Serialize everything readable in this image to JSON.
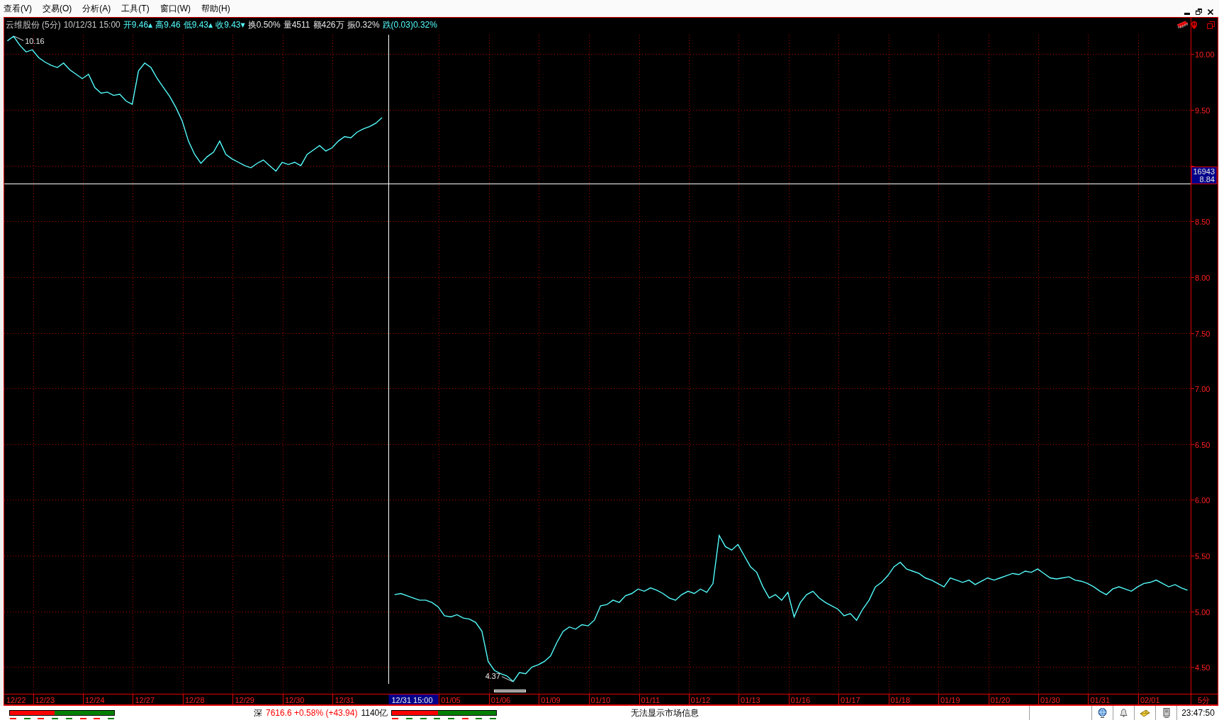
{
  "menu": [
    "查看(V)",
    "交易(O)",
    "分析(A)",
    "工具(T)",
    "窗口(W)",
    "帮助(H)"
  ],
  "chart": {
    "stock_name": "云维股份",
    "period": "(5分)",
    "time": "10/12/31 15:00",
    "quote_fields": [
      {
        "text": "开9.46",
        "arrow": "▲",
        "color": "#54fcfc"
      },
      {
        "text": "高9.46",
        "color": "#54fcfc"
      },
      {
        "text": "低9.43",
        "arrow": "▲",
        "color": "#54fcfc"
      },
      {
        "text": "收9.43",
        "arrow": "▼",
        "color": "#54fcfc"
      },
      {
        "text": "换0.50%",
        "color": "#e6e6e6"
      },
      {
        "text": "量4511",
        "color": "#e6e6e6"
      },
      {
        "text": "额426万",
        "color": "#e6e6e6"
      },
      {
        "text": "振0.32%",
        "color": "#e6e6e6"
      },
      {
        "text": "跌(0.03)0.32%",
        "color": "#54fcfc"
      }
    ],
    "corner_label": "5分",
    "crosshair": {
      "date_label": "12/31 15:00",
      "value_label": "16943"
    },
    "chart_data": {
      "type": "line",
      "grid": true,
      "categories": [
        null,
        "12/22",
        null,
        null,
        null,
        null,
        "12/23",
        null,
        null,
        null,
        null,
        null,
        null,
        null,
        "12/24",
        null,
        null,
        null,
        null,
        null,
        null,
        null,
        "12/27",
        null,
        null,
        null,
        null,
        null,
        null,
        null,
        "12/28",
        null,
        null,
        null,
        null,
        null,
        null,
        null,
        "12/29",
        null,
        null,
        null,
        null,
        null,
        null,
        null,
        "12/30",
        null,
        null,
        null,
        null,
        null,
        null,
        null,
        "12/31",
        null,
        null,
        null,
        null,
        null,
        null,
        null,
        null,
        null,
        null,
        null,
        null,
        null,
        null,
        null,
        null,
        "01/05",
        null,
        null,
        null,
        null,
        null,
        null,
        null,
        "01/06",
        null,
        null,
        null,
        null,
        null,
        null,
        null,
        "01/09",
        null,
        null,
        null,
        null,
        null,
        null,
        null,
        "01/10",
        null,
        null,
        null,
        null,
        null,
        null,
        null,
        "01/11",
        null,
        null,
        null,
        null,
        null,
        null,
        null,
        "01/12",
        null,
        null,
        null,
        null,
        null,
        null,
        null,
        "01/13",
        null,
        null,
        null,
        null,
        null,
        null,
        null,
        "01/16",
        null,
        null,
        null,
        null,
        null,
        null,
        null,
        "01/17",
        null,
        null,
        null,
        null,
        null,
        null,
        null,
        "01/18",
        null,
        null,
        null,
        null,
        null,
        null,
        null,
        "01/19",
        null,
        null,
        null,
        null,
        null,
        null,
        null,
        "01/20",
        null,
        null,
        null,
        null,
        null,
        null,
        null,
        "01/30",
        null,
        null,
        null,
        null,
        null,
        null,
        null,
        "01/31",
        null,
        null,
        null,
        null,
        null,
        null,
        null,
        "02/01",
        null,
        null,
        null,
        null,
        null,
        null
      ],
      "series": [
        {
          "color": "#54fcfc",
          "values": [
            10.12,
            10.16,
            10.08,
            10.02,
            10.04,
            9.97,
            9.93,
            9.9,
            9.88,
            9.92,
            9.86,
            9.82,
            9.78,
            9.82,
            9.7,
            9.65,
            9.66,
            9.63,
            9.64,
            9.58,
            9.55,
            9.85,
            9.92,
            9.88,
            9.78,
            9.7,
            9.62,
            9.52,
            9.4,
            9.22,
            9.1,
            9.02,
            9.08,
            9.12,
            9.22,
            9.1,
            9.06,
            9.03,
            9.0,
            8.98,
            9.02,
            9.05,
            9.0,
            8.95,
            9.03,
            9.01,
            9.03,
            9.0,
            9.1,
            9.14,
            9.18,
            9.13,
            9.16,
            9.22,
            9.26,
            9.25,
            9.3,
            9.33,
            9.35,
            9.38,
            9.43,
            null,
            5.15,
            5.16,
            5.14,
            5.12,
            5.1,
            5.1,
            5.08,
            5.04,
            4.96,
            4.95,
            4.97,
            4.94,
            4.93,
            4.9,
            4.82,
            4.55,
            4.47,
            4.44,
            4.42,
            4.37,
            4.45,
            4.44,
            4.5,
            4.52,
            4.55,
            4.6,
            4.72,
            4.82,
            4.86,
            4.84,
            4.88,
            4.87,
            4.92,
            5.05,
            5.06,
            5.1,
            5.08,
            5.14,
            5.16,
            5.2,
            5.18,
            5.21,
            5.19,
            5.16,
            5.12,
            5.1,
            5.15,
            5.18,
            5.16,
            5.2,
            5.17,
            5.25,
            5.68,
            5.58,
            5.55,
            5.6,
            5.5,
            5.4,
            5.35,
            5.22,
            5.12,
            5.15,
            5.1,
            5.17,
            4.95,
            5.08,
            5.15,
            5.18,
            5.12,
            5.08,
            5.05,
            5.02,
            4.96,
            4.98,
            4.92,
            5.02,
            5.1,
            5.22,
            5.26,
            5.32,
            5.4,
            5.44,
            5.38,
            5.36,
            5.34,
            5.3,
            5.28,
            5.25,
            5.22,
            5.3,
            5.28,
            5.26,
            5.28,
            5.24,
            5.27,
            5.3,
            5.28,
            5.3,
            5.32,
            5.34,
            5.33,
            5.36,
            5.35,
            5.38,
            5.34,
            5.3,
            5.29,
            5.3,
            5.31,
            5.28,
            5.27,
            5.25,
            5.22,
            5.18,
            5.15,
            5.2,
            5.22,
            5.2,
            5.18,
            5.22,
            5.25,
            5.26,
            5.28,
            5.25,
            5.22,
            5.24,
            5.21,
            5.19
          ]
        }
      ],
      "ylim": [
        4.26,
        10.2
      ],
      "yticks": [
        {
          "value": 10,
          "label": "10.00"
        },
        {
          "value": 9.5,
          "label": "9.50"
        },
        {
          "value": 8.5,
          "label": "8.50"
        },
        {
          "value": 8,
          "label": "8.00"
        },
        {
          "value": 7.5,
          "label": "7.50"
        },
        {
          "value": 7,
          "label": "7.00"
        },
        {
          "value": 6.5,
          "label": "6.50"
        },
        {
          "value": 6,
          "label": "6.00"
        },
        {
          "value": 5.5,
          "label": "5.50"
        },
        {
          "value": 5,
          "label": "5.00"
        },
        {
          "value": 4.5,
          "label": "4.50"
        }
      ],
      "annotations": [
        "10.16",
        "4.37"
      ],
      "ref_lines": [
        {
          "axis": "y",
          "value": 8.84,
          "label": "8.84"
        }
      ]
    }
  },
  "status_bar": {
    "markets": [
      {
        "meter": {
          "level": 0.43,
          "dashes": [
            {
              "color": "#ff0000"
            },
            {
              "color": "#008000"
            },
            {
              "color": "#ff0000"
            },
            {
              "color": "#008000"
            },
            {
              "color": "#008000"
            },
            {
              "color": "#ff0000"
            },
            {
              "color": "#ff0000"
            },
            {
              "color": "#008000"
            }
          ]
        }
      },
      {
        "name": "深",
        "quote": "7616.6 +0.58% (+43.94)",
        "turnover": "1140亿",
        "meter": {
          "level": 0.44,
          "dashes": [
            {
              "color": "#ff0000"
            },
            {
              "color": "#008000"
            },
            {
              "color": "#008000"
            },
            {
              "color": "#008000"
            },
            {
              "color": "#008000"
            },
            {
              "color": "#ff0000"
            },
            {
              "color": "#008000"
            },
            {
              "color": "#008000"
            }
          ]
        }
      }
    ],
    "message": "无法显示市场信息",
    "clock": "23:47:50"
  }
}
